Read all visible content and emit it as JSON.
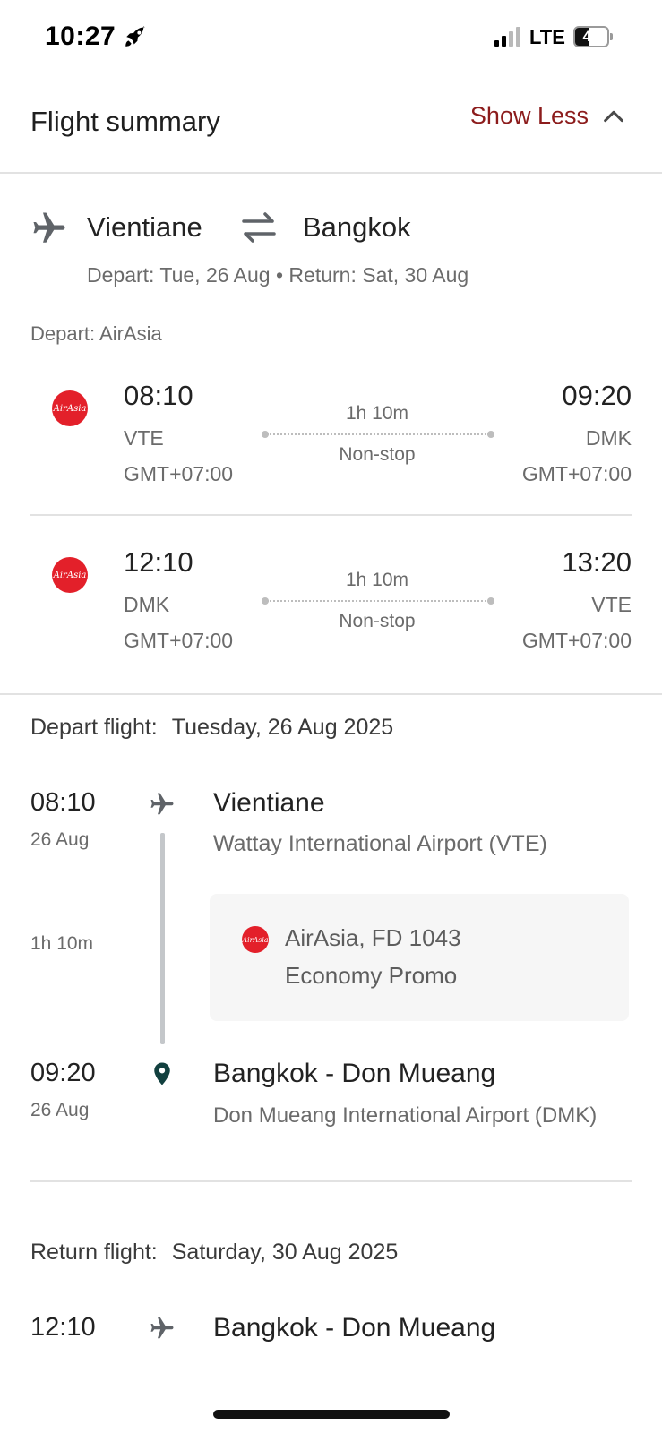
{
  "status_bar": {
    "time": "10:27",
    "network": "LTE",
    "battery_level": "44",
    "battery_fraction": 0.44
  },
  "header": {
    "title": "Flight summary",
    "toggle_label": "Show Less"
  },
  "route": {
    "origin": "Vientiane",
    "destination": "Bangkok",
    "dates": "Depart: Tue, 26 Aug • Return: Sat, 30 Aug",
    "airline_label": "Depart: AirAsia"
  },
  "legs": [
    {
      "airline_logo": "AirAsia",
      "dep_time": "08:10",
      "dep_code": "VTE",
      "dep_tz": "GMT+07:00",
      "duration": "1h 10m",
      "stops": "Non-stop",
      "arr_time": "09:20",
      "arr_code": "DMK",
      "arr_tz": "GMT+07:00"
    },
    {
      "airline_logo": "AirAsia",
      "dep_time": "12:10",
      "dep_code": "DMK",
      "dep_tz": "GMT+07:00",
      "duration": "1h 10m",
      "stops": "Non-stop",
      "arr_time": "13:20",
      "arr_code": "VTE",
      "arr_tz": "GMT+07:00"
    }
  ],
  "depart_flight": {
    "label": "Depart flight:",
    "date": "Tuesday, 26 Aug 2025",
    "dep_time": "08:10",
    "dep_date": "26 Aug",
    "dep_city": "Vientiane",
    "dep_airport": "Wattay International Airport (VTE)",
    "duration": "1h 10m",
    "carrier": "AirAsia, FD 1043",
    "cabin": "Economy Promo",
    "arr_time": "09:20",
    "arr_date": "26 Aug",
    "arr_city": "Bangkok - Don Mueang",
    "arr_airport": "Don Mueang International Airport (DMK)"
  },
  "return_flight": {
    "label": "Return flight:",
    "date": "Saturday, 30 Aug 2025",
    "dep_time": "12:10",
    "dep_city": "Bangkok - Don Mueang"
  },
  "colors": {
    "accent": "#8c1c1c",
    "airline_red": "#e3202a",
    "pin": "#12403f",
    "muted_text": "#6b6b6b"
  },
  "icons": {
    "status": [
      "rocket-icon",
      "signal-icon",
      "battery-icon"
    ],
    "header": [
      "chevron-up-icon"
    ],
    "route": [
      "plane-icon",
      "swap-arrows-icon"
    ],
    "itinerary": [
      "plane-icon",
      "location-pin-icon"
    ]
  }
}
